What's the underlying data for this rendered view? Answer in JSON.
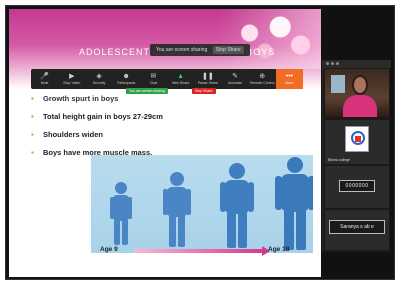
{
  "slide": {
    "title": "ADOLESCENT GROWTH SPURT- BOYS",
    "bullets": [
      "Growth spurt in boys",
      "Total height gain in boys 27-29cm",
      "Shoulders widen",
      "Boys have more muscle mass."
    ],
    "age_start": "Age 9",
    "age_end": "Age 18"
  },
  "share_banner": {
    "text": "You are screen sharing",
    "stop_label": "Stop Share"
  },
  "toolbar": {
    "items": [
      {
        "label": "Mute",
        "icon": "microphone-icon"
      },
      {
        "label": "Stop Video",
        "icon": "video-camera-icon"
      },
      {
        "label": "Security",
        "icon": "shield-icon"
      },
      {
        "label": "Participants",
        "icon": "people-icon"
      },
      {
        "label": "Chat",
        "icon": "chat-icon"
      },
      {
        "label": "New Share",
        "icon": "share-screen-icon"
      },
      {
        "label": "Pause Share",
        "icon": "pause-icon"
      },
      {
        "label": "Annotate",
        "icon": "pencil-icon"
      },
      {
        "label": "Remote Control",
        "icon": "remote-control-icon"
      },
      {
        "label": "More",
        "icon": "more-icon"
      }
    ],
    "chip_green": "You are screen sharing",
    "chip_red": "Stop Share"
  },
  "participants": {
    "video_name": "",
    "tile2_name": "Bhima college",
    "tile3_text": "0000000",
    "tile4_text": "Saranya s ab e"
  },
  "colors": {
    "accent_pink": "#c4398f",
    "bullet_orange": "#e09a1a",
    "share_green": "#2aa34a",
    "stop_red": "#dd2222",
    "more_orange": "#f26d21"
  }
}
